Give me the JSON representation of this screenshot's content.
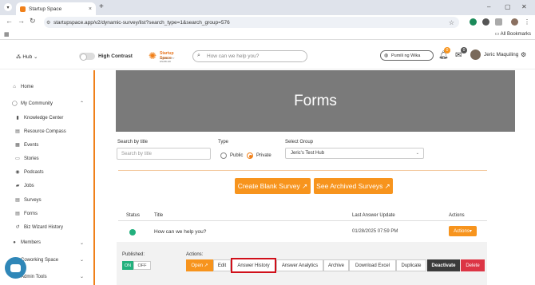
{
  "browser": {
    "tab_title": "Startup Space",
    "new_tab": "+",
    "tab_close": "×",
    "url": "startupspace.app/v2/dynamic-survey/list?search_type=1&search_group=576",
    "bookmarks_label": "All Bookmarks"
  },
  "header": {
    "hub_label": "Hub",
    "high_contrast_label": "High Contrast",
    "logo_text": "Startup Space",
    "logo_sub": "COMMUNITY ENABLED",
    "search_placeholder": "How can we help you?",
    "language_label": "Pumili ng Wika",
    "notification_count": "0",
    "message_count": "0",
    "user_name": "Jeric Maquiling"
  },
  "sidebar": {
    "home": "Home",
    "my_community": "My Community",
    "items": [
      "Knowledge Center",
      "Resource Compass",
      "Events",
      "Stories",
      "Podcasts",
      "Jobs",
      "Surveys",
      "Forms",
      "Biz Wizard History"
    ],
    "members": "Members",
    "coworking": "Coworking Space",
    "admin_tools": "Admin Tools"
  },
  "page": {
    "title": "Forms",
    "search_label": "Search by title",
    "search_placeholder": "Search by title",
    "type_label": "Type",
    "type_public": "Public",
    "type_private": "Private",
    "group_label": "Select Group",
    "group_value": "Jeric's Test Hub",
    "create_button": "Create Blank Survey ↗",
    "archived_button": "See Archived Surveys ↗"
  },
  "table": {
    "headers": {
      "status": "Status",
      "title": "Title",
      "last_answer": "Last Answer Update",
      "actions": "Actions"
    },
    "row": {
      "title": "How can we help you?",
      "last_answer": "01/28/2025 07:59 PM",
      "actions_label": "Actions▾"
    }
  },
  "detail": {
    "published_label": "Published:",
    "on_label": "ON",
    "off_label": "OFF",
    "actions_label": "Actions:",
    "buttons": [
      "Open ↗",
      "Edit",
      "Answer History",
      "Answer Analytics",
      "Archive",
      "Download Excel",
      "Duplicate",
      "Deactivate",
      "Delete"
    ]
  },
  "colors": {
    "accent": "#f7941d",
    "green": "#22b07d",
    "highlight": "#d0101a",
    "dark": "#3b3b3b",
    "danger": "#dc3545"
  }
}
